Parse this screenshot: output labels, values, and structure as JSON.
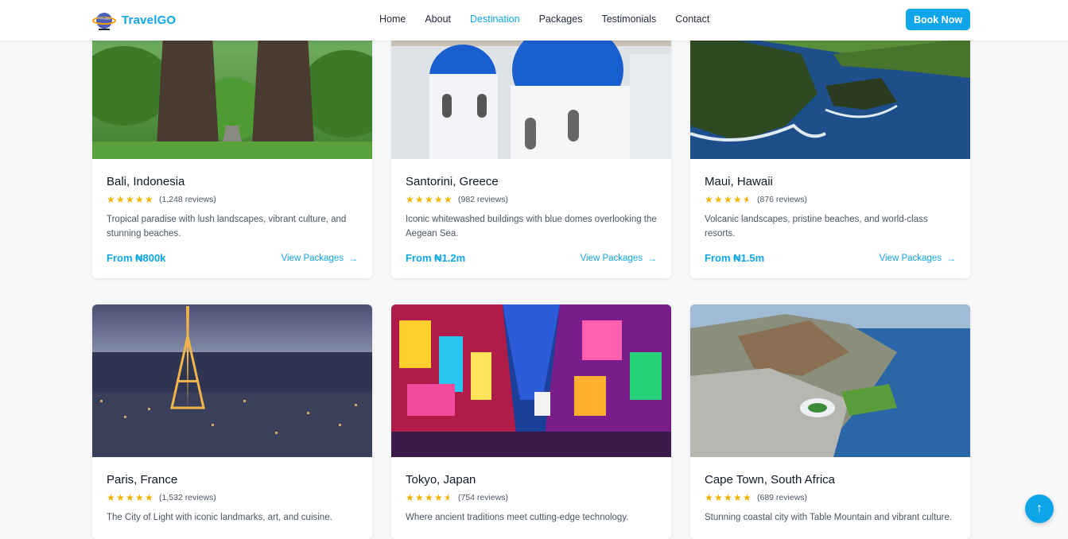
{
  "brand": {
    "name": "TravelGO",
    "logo_icon": "airplane-globe-logo"
  },
  "nav": {
    "links": [
      "Home",
      "About",
      "Destination",
      "Packages",
      "Testimonials",
      "Contact"
    ],
    "active": "Destination",
    "cta": "Book Now"
  },
  "colors": {
    "accent": "#0ea5e9",
    "star": "#f5b301"
  },
  "destinations": [
    {
      "name": "Bali, Indonesia",
      "rating": 5,
      "reviews": "(1,248 reviews)",
      "description": "Tropical paradise with lush landscapes, vibrant culture, and stunning beaches.",
      "price": "From ₦800k",
      "link": "View Packages",
      "image": "bali-temple-gate"
    },
    {
      "name": "Santorini, Greece",
      "rating": 5,
      "reviews": "(982 reviews)",
      "description": "Iconic whitewashed buildings with blue domes overlooking the Aegean Sea.",
      "price": "From ₦1.2m",
      "link": "View Packages",
      "image": "santorini-blue-domes"
    },
    {
      "name": "Maui, Hawaii",
      "rating": 4.5,
      "reviews": "(876 reviews)",
      "description": "Volcanic landscapes, pristine beaches, and world-class resorts.",
      "price": "From ₦1.5m",
      "link": "View Packages",
      "image": "maui-coastline"
    },
    {
      "name": "Paris, France",
      "rating": 5,
      "reviews": "(1,532 reviews)",
      "description": "The City of Light with iconic landmarks, art, and cuisine.",
      "price": "",
      "link": "",
      "image": "paris-eiffel-night"
    },
    {
      "name": "Tokyo, Japan",
      "rating": 4.5,
      "reviews": "(754 reviews)",
      "description": "Where ancient traditions meet cutting-edge technology.",
      "price": "",
      "link": "",
      "image": "tokyo-neon-street"
    },
    {
      "name": "Cape Town, South Africa",
      "rating": 5,
      "reviews": "(689 reviews)",
      "description": "Stunning coastal city with Table Mountain and vibrant culture.",
      "price": "",
      "link": "",
      "image": "cape-town-aerial"
    }
  ],
  "scroll_top_icon": "arrow-up-icon"
}
